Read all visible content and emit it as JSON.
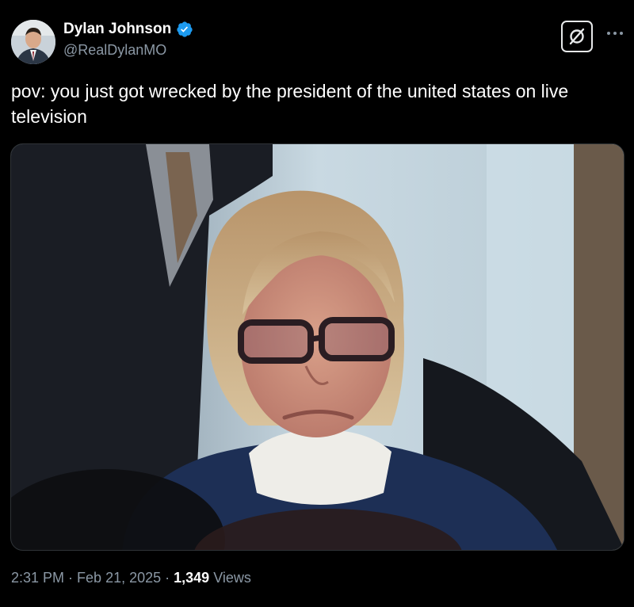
{
  "author": {
    "display_name": "Dylan Johnson",
    "handle": "@RealDylanMO",
    "verified": true,
    "verified_color": "#1d9bf0"
  },
  "actions": {
    "grok_icon": "grok-icon",
    "more_icon": "more-icon"
  },
  "tweet": {
    "text": "pov: you just got wrecked by the president of the united states on live television"
  },
  "media": {
    "type": "photo"
  },
  "meta": {
    "time": "2:31 PM",
    "separator": " · ",
    "date": "Feb 21, 2025",
    "views_count": "1,349",
    "views_label": " Views"
  },
  "colors": {
    "background": "#000000",
    "text": "#ffffff",
    "secondary": "#8b98a5"
  }
}
